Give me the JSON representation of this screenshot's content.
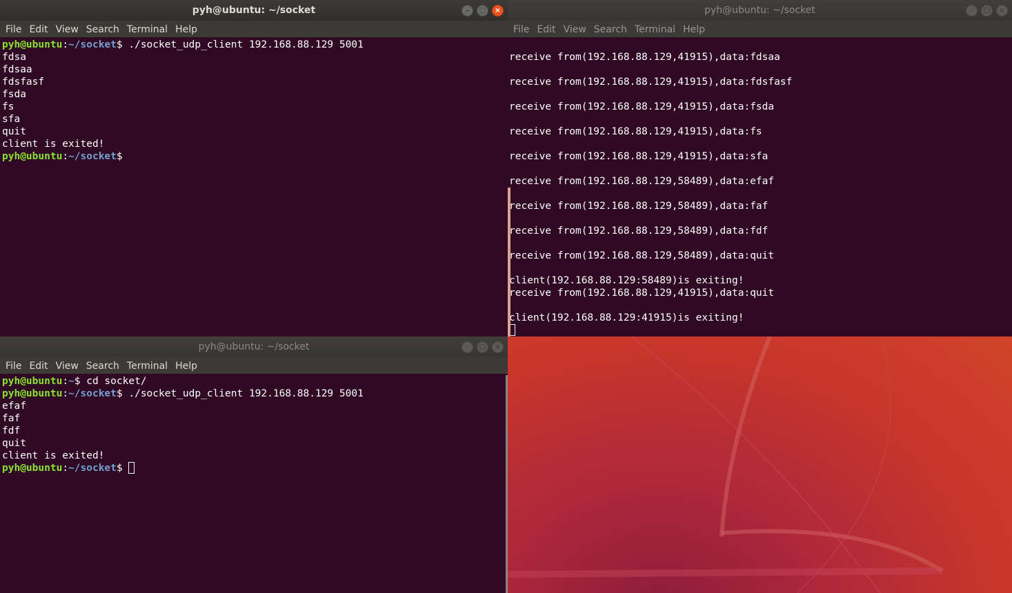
{
  "menu": [
    "File",
    "Edit",
    "View",
    "Search",
    "Terminal",
    "Help"
  ],
  "window_top_left": {
    "title": "pyh@ubuntu: ~/socket",
    "lines": [
      {
        "user": "pyh@ubuntu",
        "sep": ":",
        "path": "~/socket",
        "prompt": "$",
        "cmd": " ./socket_udp_client 192.168.88.129 5001"
      },
      {
        "text": "fdsa"
      },
      {
        "text": "fdsaa"
      },
      {
        "text": "fdsfasf"
      },
      {
        "text": "fsda"
      },
      {
        "text": "fs"
      },
      {
        "text": "sfa"
      },
      {
        "text": "quit"
      },
      {
        "text": "client is exited!"
      },
      {
        "user": "pyh@ubuntu",
        "sep": ":",
        "path": "~/socket",
        "prompt": "$",
        "cmd": ""
      }
    ]
  },
  "window_bottom_left": {
    "title": "pyh@ubuntu: ~/socket",
    "lines": [
      {
        "user": "pyh@ubuntu",
        "sep": ":",
        "path": "~",
        "prompt": "$",
        "cmd": " cd socket/"
      },
      {
        "user": "pyh@ubuntu",
        "sep": ":",
        "path": "~/socket",
        "prompt": "$",
        "cmd": " ./socket_udp_client 192.168.88.129 5001"
      },
      {
        "text": "efaf"
      },
      {
        "text": "faf"
      },
      {
        "text": "fdf"
      },
      {
        "text": "quit"
      },
      {
        "text": "client is exited!"
      },
      {
        "user": "pyh@ubuntu",
        "sep": ":",
        "path": "~/socket",
        "prompt": "$",
        "cmd": " ",
        "cursor": true
      }
    ]
  },
  "window_right": {
    "title": "pyh@ubuntu: ~/socket",
    "lines": [
      "",
      "receive from(192.168.88.129,41915),data:fdsaa",
      "",
      "receive from(192.168.88.129,41915),data:fdsfasf",
      "",
      "receive from(192.168.88.129,41915),data:fsda",
      "",
      "receive from(192.168.88.129,41915),data:fs",
      "",
      "receive from(192.168.88.129,41915),data:sfa",
      "",
      "receive from(192.168.88.129,58489),data:efaf",
      "",
      "receive from(192.168.88.129,58489),data:faf",
      "",
      "receive from(192.168.88.129,58489),data:fdf",
      "",
      "receive from(192.168.88.129,58489),data:quit",
      "",
      "client(192.168.88.129:58489)is exiting!",
      "receive from(192.168.88.129,41915),data:quit",
      "",
      "client(192.168.88.129:41915)is exiting!"
    ]
  }
}
